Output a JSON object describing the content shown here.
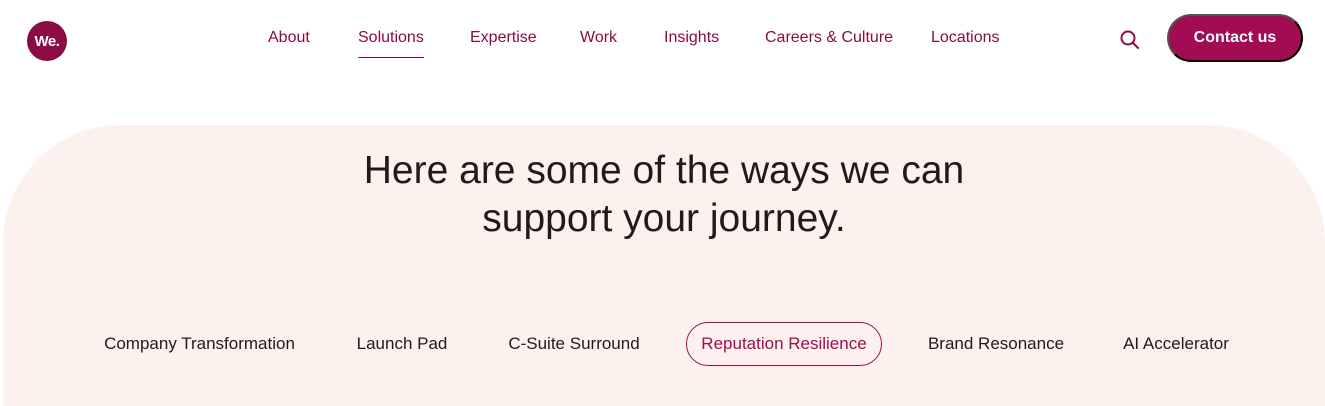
{
  "brand": {
    "logo_text": "We."
  },
  "nav": {
    "items": [
      {
        "label": "About"
      },
      {
        "label": "Solutions"
      },
      {
        "label": "Expertise"
      },
      {
        "label": "Work"
      },
      {
        "label": "Insights"
      },
      {
        "label": "Careers & Culture"
      },
      {
        "label": "Locations"
      }
    ],
    "active_item": "Solutions",
    "search_icon": "search-icon",
    "contact_label": "Contact us"
  },
  "hero": {
    "title_line_1": "Here are some of the ways we can",
    "title_line_2": "support your journey."
  },
  "solutions_tabs": {
    "items": [
      {
        "label": "Company Transformation"
      },
      {
        "label": "Launch Pad"
      },
      {
        "label": "C-Suite Surround"
      },
      {
        "label": "Reputation Resilience"
      },
      {
        "label": "Brand Resonance"
      },
      {
        "label": "AI Accelerator"
      }
    ],
    "selected_item": "Reputation Resilience"
  },
  "colors": {
    "brand": "#8b0b43",
    "button": "#a10c52",
    "hero_background": "#fcf1ec",
    "text": "#201b1b"
  }
}
